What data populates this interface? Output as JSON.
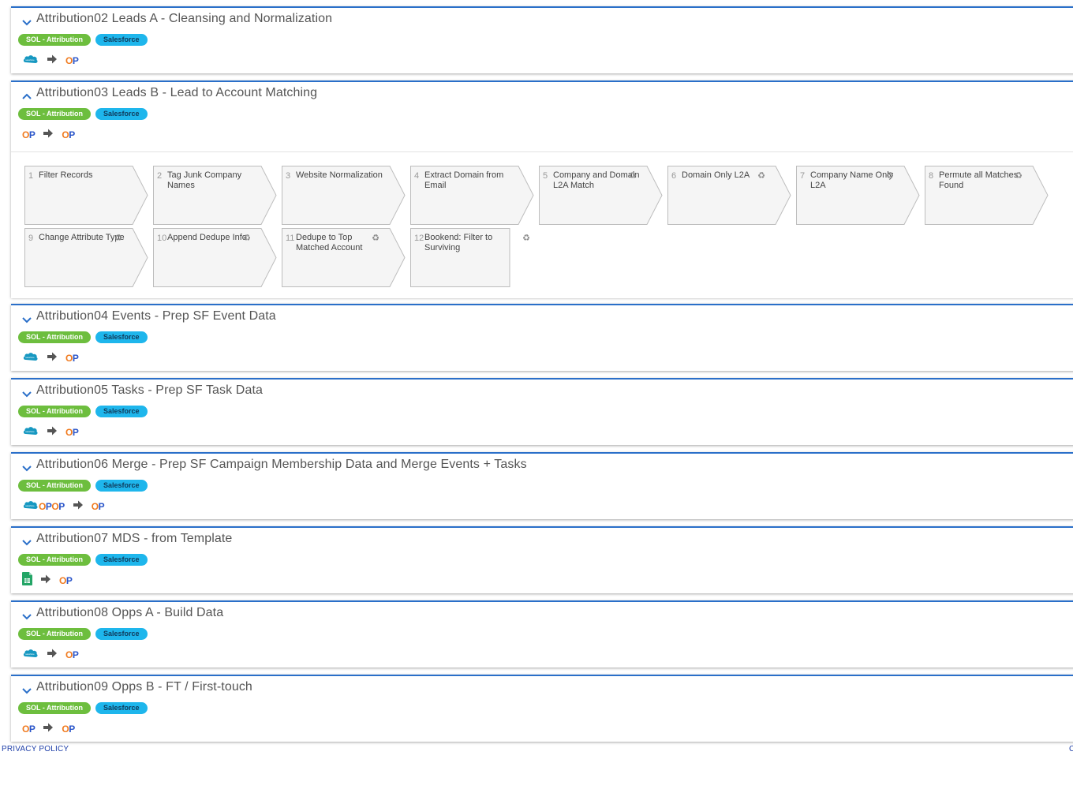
{
  "pipelines": [
    {
      "title": "Attribution02 Leads A - Cleansing and Normalization",
      "expanded": false,
      "tags": [
        "SOL - Attribution",
        "Salesforce"
      ],
      "sources": [
        "salesforce-icon"
      ],
      "destinations": [
        "op-icon"
      ]
    },
    {
      "title": "Attribution03 Leads B - Lead to Account Matching",
      "expanded": true,
      "tags": [
        "SOL - Attribution",
        "Salesforce"
      ],
      "sources": [
        "op-icon"
      ],
      "destinations": [
        "op-icon"
      ],
      "steps": [
        {
          "num": "1",
          "label": "Filter Records",
          "recycle": false
        },
        {
          "num": "2",
          "label": "Tag Junk Company Names",
          "recycle": false
        },
        {
          "num": "3",
          "label": "Website Normalization",
          "recycle": false
        },
        {
          "num": "4",
          "label": "Extract Domain from Email",
          "recycle": false
        },
        {
          "num": "5",
          "label": "Company and Domain L2A Match",
          "recycle": true
        },
        {
          "num": "6",
          "label": "Domain Only L2A",
          "recycle": true
        },
        {
          "num": "7",
          "label": "Company Name Only L2A",
          "recycle": true
        },
        {
          "num": "8",
          "label": "Permute all Matches Found",
          "recycle": true
        },
        {
          "num": "9",
          "label": "Change Attribute Type",
          "recycle": true
        },
        {
          "num": "10",
          "label": "Append Dedupe Info",
          "recycle": true
        },
        {
          "num": "11",
          "label": "Dedupe to Top Matched Account",
          "recycle": true
        },
        {
          "num": "12",
          "label": "Bookend: Filter to Surviving",
          "recycle": true
        }
      ]
    },
    {
      "title": "Attribution04 Events - Prep SF Event Data",
      "expanded": false,
      "tags": [
        "SOL - Attribution",
        "Salesforce"
      ],
      "sources": [
        "salesforce-icon"
      ],
      "destinations": [
        "op-icon"
      ]
    },
    {
      "title": "Attribution05 Tasks - Prep SF Task Data",
      "expanded": false,
      "tags": [
        "SOL - Attribution",
        "Salesforce"
      ],
      "sources": [
        "salesforce-icon"
      ],
      "destinations": [
        "op-icon"
      ]
    },
    {
      "title": "Attribution06 Merge - Prep SF Campaign Membership Data and Merge Events + Tasks",
      "expanded": false,
      "tags": [
        "SOL - Attribution",
        "Salesforce"
      ],
      "sources": [
        "salesforce-icon",
        "op-icon",
        "op-icon"
      ],
      "destinations": [
        "op-icon"
      ]
    },
    {
      "title": "Attribution07 MDS - from Template",
      "expanded": false,
      "tags": [
        "SOL - Attribution",
        "Salesforce"
      ],
      "sources": [
        "google-sheets-icon"
      ],
      "destinations": [
        "op-icon"
      ]
    },
    {
      "title": "Attribution08 Opps A - Build Data",
      "expanded": false,
      "tags": [
        "SOL - Attribution",
        "Salesforce"
      ],
      "sources": [
        "salesforce-icon"
      ],
      "destinations": [
        "op-icon"
      ]
    },
    {
      "title": "Attribution09 Opps B - FT / First-touch",
      "expanded": false,
      "tags": [
        "SOL - Attribution",
        "Salesforce"
      ],
      "sources": [
        "op-icon"
      ],
      "destinations": [
        "op-icon"
      ]
    }
  ],
  "icons": {
    "op_o": "O",
    "op_p": "P",
    "salesforce_text": "salesforce",
    "recycle": "♻"
  },
  "colors": {
    "accent": "#2a6fc9",
    "tag_green": "#6dbe3e",
    "tag_blue": "#1eb6ec",
    "op_orange": "#f07a1e",
    "op_blue": "#2a55c9",
    "salesforce": "#1798c1"
  },
  "footer": {
    "privacy": "PRIVACY POLICY",
    "edge": "C"
  }
}
